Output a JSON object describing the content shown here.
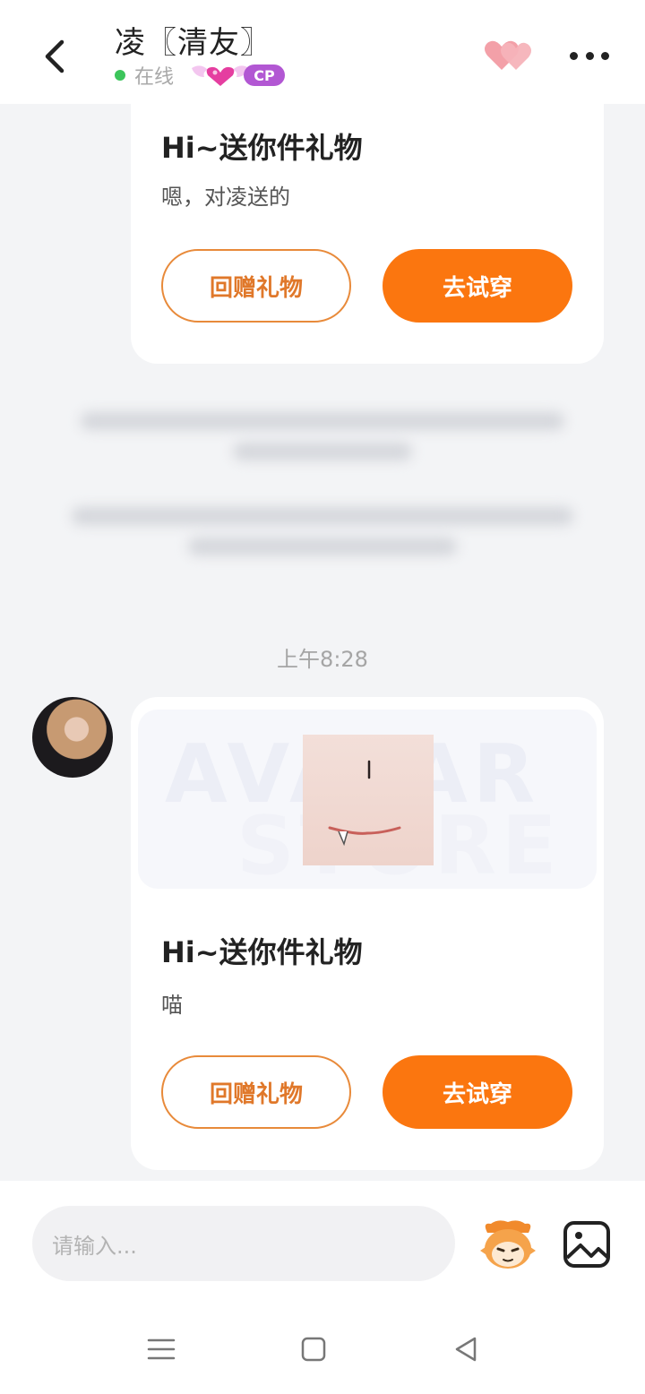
{
  "header": {
    "title": "凌〖清友〗",
    "status": "在线",
    "badge": "CP"
  },
  "messages": [
    {
      "title": "Hi~送你件礼物",
      "text": "嗯，对凌送的",
      "return_gift_label": "回赠礼物",
      "try_on_label": "去试穿"
    },
    {
      "time": "上午8:28",
      "watermark_top": "AVATAR",
      "watermark_bottom": "STORE",
      "title": "Hi~送你件礼物",
      "text": "喵",
      "return_gift_label": "回赠礼物",
      "try_on_label": "去试穿"
    }
  ],
  "input": {
    "placeholder": "请输入..."
  },
  "colors": {
    "accent": "#fb760f",
    "online": "#3cc55b",
    "cp_badge": "#b257d3"
  },
  "icons": [
    "back-arrow-icon",
    "hearts-icon",
    "more-icon",
    "emoji-icon",
    "image-icon",
    "menu-icon",
    "home-icon",
    "back-triangle-icon"
  ]
}
